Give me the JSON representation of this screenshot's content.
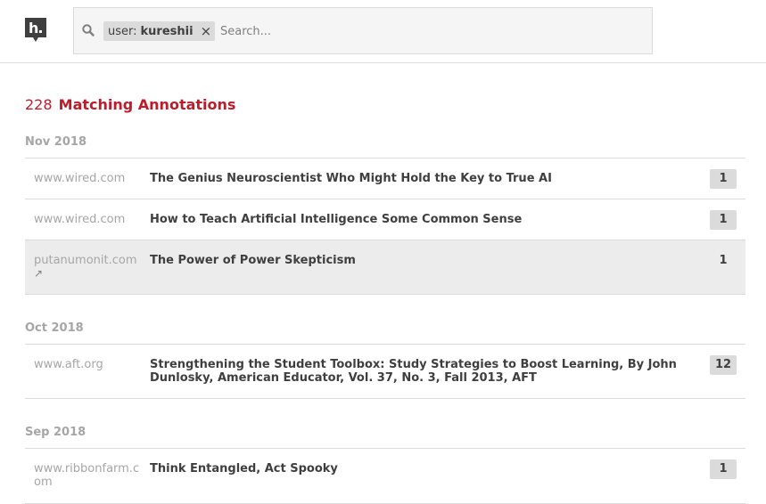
{
  "header": {
    "logo_icon": "hypothesis-logo-icon",
    "search": {
      "icon": "search-icon",
      "facet_label": "user:",
      "facet_value": "kureshii",
      "remove_icon": "close-icon",
      "remove_glyph": "×",
      "placeholder": "Search..."
    }
  },
  "results": {
    "count": "228",
    "label": "Matching Annotations"
  },
  "periods": [
    {
      "title": "Nov 2018",
      "items": [
        {
          "domain": "www.wired.com",
          "title": "The Genius Neuroscientist Who Might Hold the Key to True AI",
          "count": "1"
        },
        {
          "domain": "www.wired.com",
          "title": "How to Teach Artificial Intelligence Some Common Sense",
          "count": "1"
        },
        {
          "domain": "putanumonit.com",
          "title": "The Power of Power Skepticism",
          "count": "1",
          "ext_glyph": "↗"
        }
      ]
    },
    {
      "title": "Oct 2018",
      "items": [
        {
          "domain": "www.aft.org",
          "title": "Strengthening the Student Toolbox: Study Strategies to Boost Learning, By John Dunlosky, American Educator, Vol. 37, No. 3, Fall 2013, AFT",
          "count": "12"
        }
      ]
    },
    {
      "title": "Sep 2018",
      "items": [
        {
          "domain": "www.ribbonfarm.com",
          "title": "Think Entangled, Act Spooky",
          "count": "1"
        }
      ]
    }
  ],
  "colors": {
    "brand": "#bd1c2b",
    "muted": "#a6a6a6",
    "border": "#dbdbdb",
    "hover_row": "#ececec"
  }
}
